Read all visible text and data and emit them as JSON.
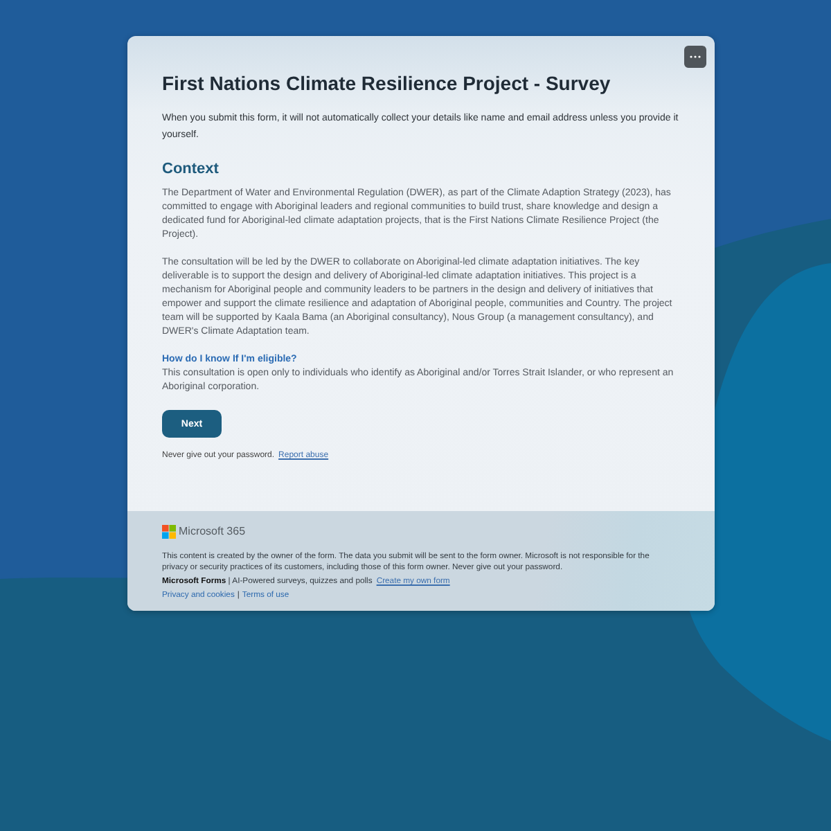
{
  "form": {
    "title": "First Nations Climate Resilience Project - Survey",
    "privacy_notice": "When you submit this form, it will not automatically collect your details like name and email address unless you provide it yourself.",
    "sections": [
      {
        "kind": "heading",
        "text": "Context"
      },
      {
        "kind": "paragraph",
        "text": "The Department of Water and Environmental Regulation (DWER), as part of the Climate Adaption Strategy (2023), has committed to engage with Aboriginal leaders and regional communities to build trust, share knowledge and design a dedicated fund for Aboriginal-led climate adaptation projects, that is the First Nations Climate Resilience Project (the Project)."
      },
      {
        "kind": "paragraph",
        "text": "The consultation will be led by the DWER to collaborate on Aboriginal-led climate adaptation initiatives. The key deliverable is to support the design and delivery of Aboriginal-led climate adaptation initiatives. This project is a mechanism for Aboriginal people and community leaders to be partners in the design and delivery of initiatives that empower and support the climate resilience and adaptation of Aboriginal people, communities and Country. The project team will be supported by Kaala Bama (an Aboriginal consultancy), Nous Group (a management consultancy), and DWER's Climate Adaptation team."
      },
      {
        "kind": "subheading",
        "text": "How do I know If I'm eligible?"
      },
      {
        "kind": "paragraph",
        "text": "This consultation is open only to individuals who identify as Aboriginal and/or Torres Strait Islander, or who represent an Aboriginal corporation."
      }
    ],
    "next_button": "Next",
    "password_warning": "Never give out your password.",
    "report_link": "Report abuse"
  },
  "footer": {
    "brand": "Microsoft 365",
    "disclaimer": "This content is created by the owner of the form. The data you submit will be sent to the form owner. Microsoft is not responsible for the privacy or security practices of its customers, including those of this form owner. Never give out your password.",
    "tagline": "**Microsoft Forms** | AI-Powered surveys, quizzes and polls",
    "create_link": "Create my own form",
    "links": [
      "Privacy and cookies",
      "Terms of use"
    ],
    "separator": "|"
  }
}
